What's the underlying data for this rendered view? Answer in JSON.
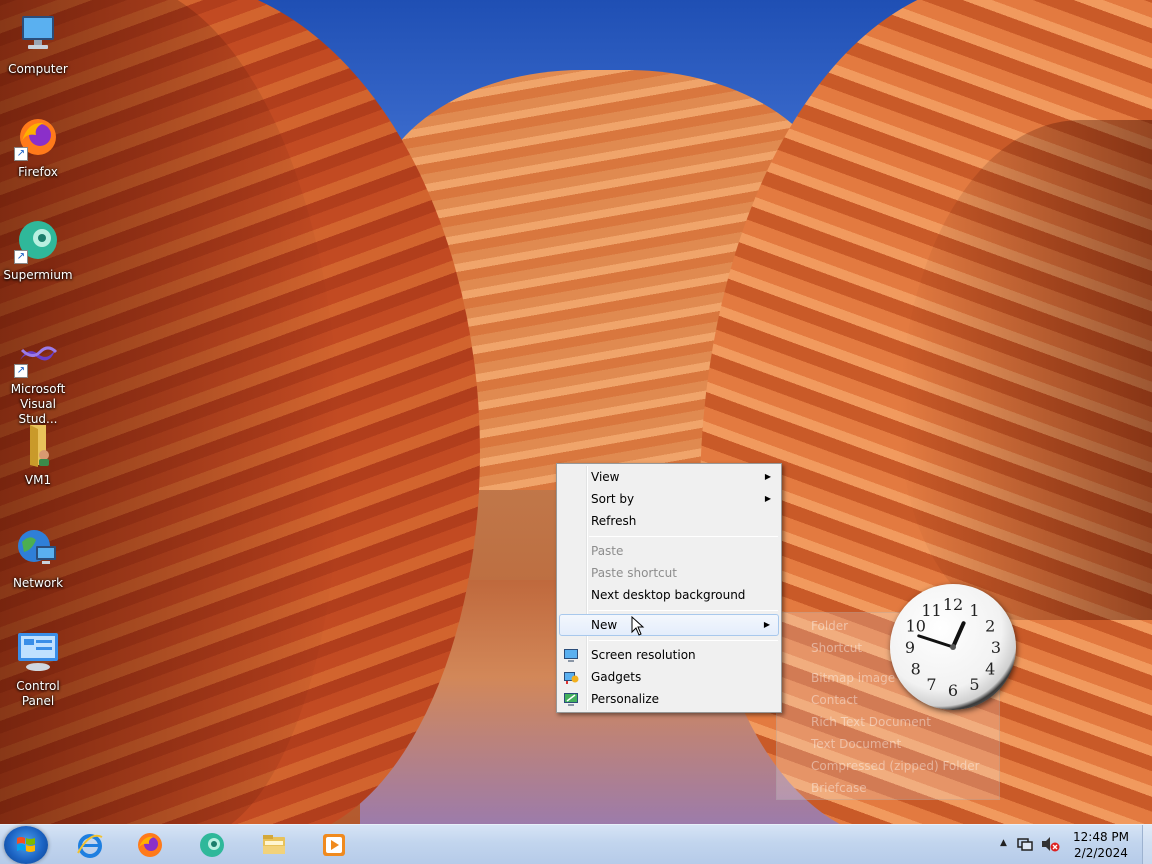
{
  "desktop_icons": [
    {
      "label": "Computer",
      "icon": "computer-icon"
    },
    {
      "label": "Firefox",
      "icon": "firefox-icon"
    },
    {
      "label": "Supermium",
      "icon": "supermium-icon"
    },
    {
      "label": "Microsoft Visual Stud...",
      "icon": "visual-studio-icon"
    },
    {
      "label": "VM1",
      "icon": "folder-icon"
    },
    {
      "label": "Network",
      "icon": "network-icon"
    },
    {
      "label": "Control Panel",
      "icon": "control-panel-icon"
    }
  ],
  "context_menu": {
    "view": "View",
    "sort_by": "Sort by",
    "refresh": "Refresh",
    "paste": "Paste",
    "paste_shortcut": "Paste shortcut",
    "next_background": "Next desktop background",
    "new": "New",
    "screen_resolution": "Screen resolution",
    "gadgets": "Gadgets",
    "personalize": "Personalize"
  },
  "new_submenu": {
    "items": [
      "Folder",
      "Shortcut",
      "Bitmap image",
      "Contact",
      "Rich Text Document",
      "Text Document",
      "Compressed (zipped) Folder",
      "Briefcase"
    ]
  },
  "clock_gadget": {
    "hour": 12,
    "minute": 48,
    "numerals": [
      "12",
      "1",
      "2",
      "3",
      "4",
      "5",
      "6",
      "7",
      "8",
      "9",
      "10",
      "11"
    ]
  },
  "taskbar": {
    "apps": [
      "internet-explorer-icon",
      "firefox-icon",
      "supermium-icon",
      "file-explorer-icon",
      "media-player-icon"
    ],
    "time": "12:48 PM",
    "date": "2/2/2024"
  }
}
